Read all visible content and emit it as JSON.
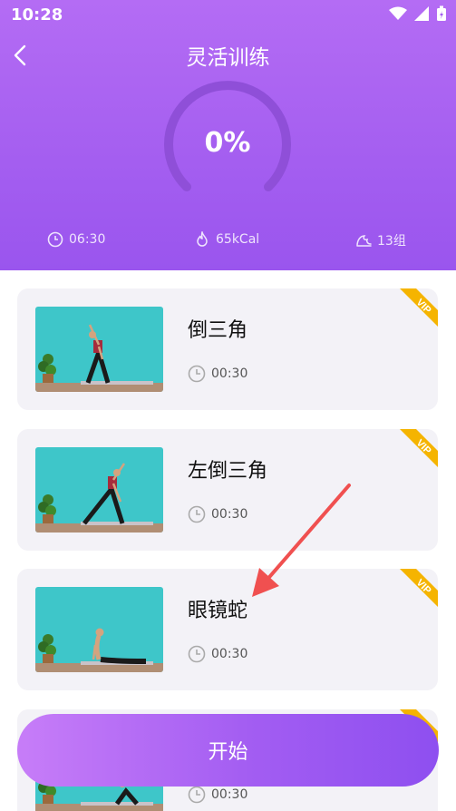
{
  "status_bar": {
    "time": "10:28"
  },
  "header": {
    "title": "灵活训练"
  },
  "progress": {
    "percent_text": "0%",
    "percent": 0
  },
  "stats": {
    "duration": "06:30",
    "calories": "65kCal",
    "sets": "13组"
  },
  "exercises": [
    {
      "name": "倒三角",
      "duration": "00:30",
      "badge": "VIP"
    },
    {
      "name": "左倒三角",
      "duration": "00:30",
      "badge": "VIP"
    },
    {
      "name": "眼镜蛇",
      "duration": "00:30",
      "badge": "VIP"
    },
    {
      "name": "",
      "duration": "00:30",
      "badge": "VIP"
    }
  ],
  "start_button": {
    "label": "开始"
  },
  "colors": {
    "header": "#a45ef0",
    "card": "#f3f2f7",
    "vip": "#f5b400",
    "arrow": "#f05050"
  }
}
